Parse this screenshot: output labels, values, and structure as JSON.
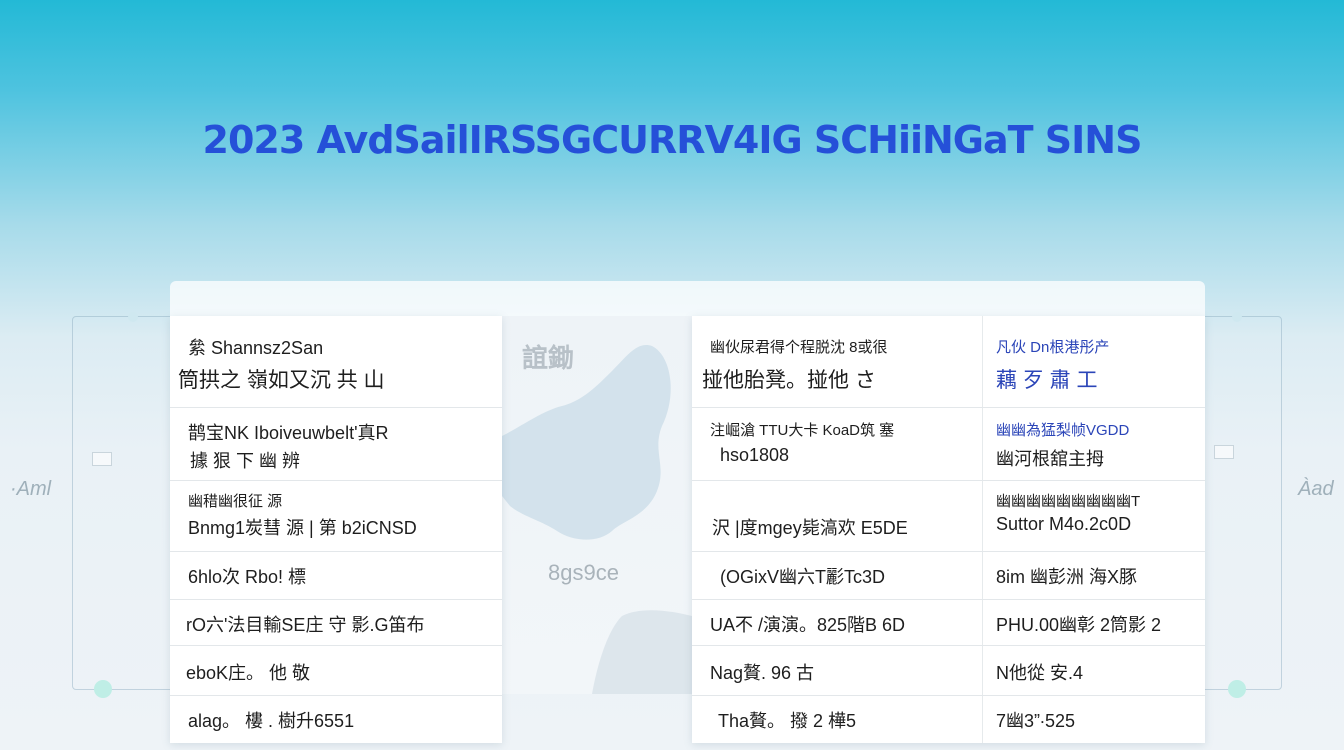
{
  "headline": "2023 AvdSailIRSSGCURRV4IG SCHiiNGaT SINS",
  "map": {
    "label_top": "誼鋤",
    "label_mid": "8gs9ce"
  },
  "side_labels": {
    "left": "·Aml",
    "right": "Àad"
  },
  "left_panel": {
    "rows": [
      {
        "line1": "絫 Shannsz2San",
        "line2": "筒拱之 嶺如又沉 共 山"
      },
      {
        "line1": "鹊宝NK  Iboiveuwbelt'真R",
        "line2": "據 狠 下 幽 辨"
      },
      {
        "line1": "幽稓幽很征 源",
        "line2": "Bnmg1炭彗 源  |  第 b2iCNSD"
      },
      {
        "line1": "6hlo次 Rbo! 標",
        "line2": ""
      },
      {
        "line1": "rO六'法目輸SE庄 守 影.G笛布",
        "line2": ""
      },
      {
        "line1": "eboK庄。 他 敬",
        "line2": ""
      },
      {
        "line1": "alag。 樓 . 樹升6551",
        "line2": ""
      }
    ]
  },
  "right_panel": {
    "rows": [
      {
        "left1": "幽伙尿君得个程脱沈 8或很",
        "left2": "掽他胎凳。掽他 さ",
        "right1": "凡伙 Dn根港彤产",
        "right2": "藕 歹 肅 工"
      },
      {
        "left1": "注崛滄 TTU大卡 KoaD筑 塞",
        "left2": "hso1808",
        "right1": "幽幽為猛梨帧VGDD",
        "right2": "幽河根舘主拇"
      },
      {
        "left1": "沢 |度mgey毙滈欢 E5DE",
        "left2": "",
        "right1": "幽幽幽幽幽幽幽幽幽T",
        "right2": "Suttor M4o.2c0D"
      },
      {
        "left1": "(OGixV幽六T彲Tc3D",
        "left2": "",
        "right1": "8im 幽彭洲 海Χ豚",
        "right2": ""
      },
      {
        "left1": "UA不 /演演。825階B 6D",
        "left2": "",
        "right1": "PHU.00幽彰 2筒影 2",
        "right2": ""
      },
      {
        "left1": "Nag贅. 96  古",
        "left2": "",
        "right1": "N他從 安.4",
        "right2": ""
      },
      {
        "left1": "Tha贅。 撥 2 樺5",
        "left2": "",
        "right1": "7幽3”∙525",
        "right2": ""
      }
    ]
  }
}
